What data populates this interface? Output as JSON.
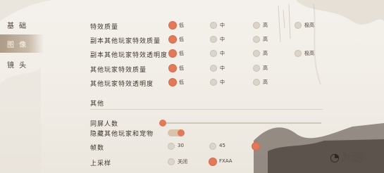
{
  "nav": {
    "items": [
      {
        "label": "基 础",
        "active": false
      },
      {
        "label": "图 像",
        "active": true
      },
      {
        "label": "镜 头",
        "active": false
      }
    ]
  },
  "effects": {
    "rows": [
      {
        "label": "特效质量",
        "options": [
          {
            "label": "低",
            "selected": true
          },
          {
            "label": "中",
            "selected": false
          },
          {
            "label": "高",
            "selected": false
          },
          {
            "label": "极高",
            "selected": false
          }
        ]
      },
      {
        "label": "副本其他玩家特效质量",
        "options": [
          {
            "label": "低",
            "selected": true
          },
          {
            "label": "中",
            "selected": false
          },
          {
            "label": "高",
            "selected": false
          }
        ]
      },
      {
        "label": "副本其他玩家特效透明度",
        "options": [
          {
            "label": "低",
            "selected": true
          },
          {
            "label": "中",
            "selected": false
          },
          {
            "label": "高",
            "selected": false
          },
          {
            "label": "极高",
            "selected": false
          }
        ]
      },
      {
        "label": "其他玩家特效质量",
        "options": [
          {
            "label": "低",
            "selected": true
          },
          {
            "label": "中",
            "selected": false
          },
          {
            "label": "高",
            "selected": false
          }
        ]
      },
      {
        "label": "其他玩家特效透明度",
        "options": [
          {
            "label": "低",
            "selected": true
          },
          {
            "label": "中",
            "selected": false
          },
          {
            "label": "高",
            "selected": false
          }
        ]
      }
    ]
  },
  "other": {
    "title": "其他",
    "same_screen": {
      "label": "同屏人数",
      "value_fraction": 0.02
    },
    "hide_players": {
      "label": "隐藏其他玩家和宠物",
      "on": true
    },
    "fps": {
      "label": "帧数",
      "options": [
        {
          "label": "30",
          "selected": false
        },
        {
          "label": "45",
          "selected": false
        },
        {
          "label": "",
          "selected": true
        }
      ]
    },
    "upsample": {
      "label": "上采样",
      "options": [
        {
          "label": "关闭",
          "selected": false
        },
        {
          "label": "FXAA",
          "selected": true
        }
      ]
    }
  },
  "watermark": {
    "icon": "jiuyou-logo-icon",
    "text": "九游"
  },
  "colors": {
    "accent": "#e07a5a",
    "radio_off": "#dad4ca",
    "active_nav": "#a89680",
    "background": "#f2eee8"
  }
}
